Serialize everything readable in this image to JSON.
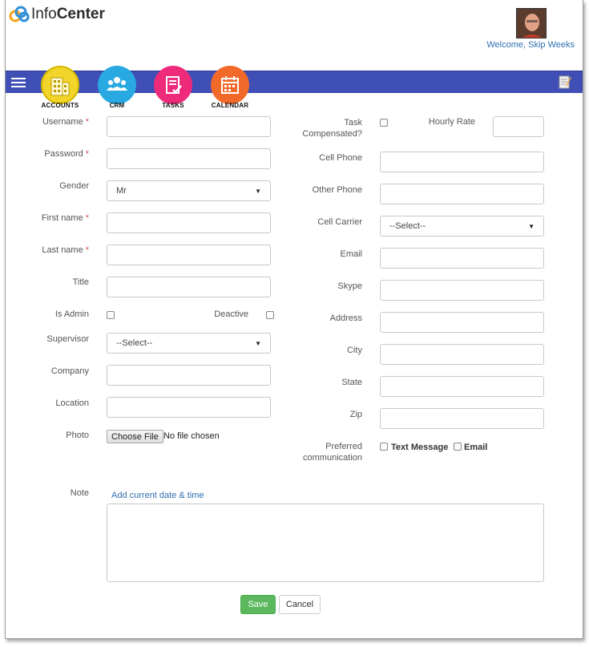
{
  "header": {
    "logo_text_light": "Info",
    "logo_text_bold": "Center",
    "welcome": "Welcome, Skip Weeks"
  },
  "nav": {
    "apps": [
      {
        "label": "ACCOUNTS",
        "color": "#f1d52a"
      },
      {
        "label": "CRM",
        "color": "#29a9e1"
      },
      {
        "label": "TASKS",
        "color": "#ee2a7b"
      },
      {
        "label": "CALENDAR",
        "color": "#f26a2a"
      }
    ],
    "bar_color": "#3f4fb6"
  },
  "form": {
    "left": {
      "username": {
        "label": "Username",
        "required": "*",
        "value": ""
      },
      "password": {
        "label": "Password",
        "required": "*",
        "value": ""
      },
      "gender": {
        "label": "Gender",
        "value": "Mr"
      },
      "first_name": {
        "label": "First name",
        "required": "*",
        "value": ""
      },
      "last_name": {
        "label": "Last name",
        "required": "*",
        "value": ""
      },
      "title": {
        "label": "Title",
        "value": ""
      },
      "is_admin": {
        "label": "Is Admin",
        "checked": false
      },
      "deactive": {
        "label": "Deactive",
        "checked": false
      },
      "supervisor": {
        "label": "Supervisor",
        "value": "--Select--"
      },
      "company": {
        "label": "Company",
        "value": ""
      },
      "location": {
        "label": "Location",
        "value": ""
      },
      "photo": {
        "label": "Photo",
        "button": "Choose File",
        "status": "No file chosen"
      }
    },
    "right": {
      "task_comp": {
        "label_line1": "Task",
        "label_line2": "Compensated?",
        "checked": false
      },
      "hourly_rate": {
        "label": "Hourly Rate",
        "value": ""
      },
      "cell_phone": {
        "label": "Cell Phone",
        "value": ""
      },
      "other_phone": {
        "label": "Other Phone",
        "value": ""
      },
      "cell_carrier": {
        "label": "Cell Carrier",
        "value": "--Select--"
      },
      "email": {
        "label": "Email",
        "value": ""
      },
      "skype": {
        "label": "Skype",
        "value": ""
      },
      "address": {
        "label": "Address",
        "value": ""
      },
      "city": {
        "label": "City",
        "value": ""
      },
      "state": {
        "label": "State",
        "value": ""
      },
      "zip": {
        "label": "Zip",
        "value": ""
      },
      "preferred": {
        "label_line1": "Preferred",
        "label_line2": "communication",
        "opt_text": "Text Message",
        "opt_email": "Email"
      }
    },
    "note": {
      "label": "Note",
      "link": "Add current date & time",
      "value": ""
    },
    "actions": {
      "save": "Save",
      "cancel": "Cancel"
    }
  }
}
